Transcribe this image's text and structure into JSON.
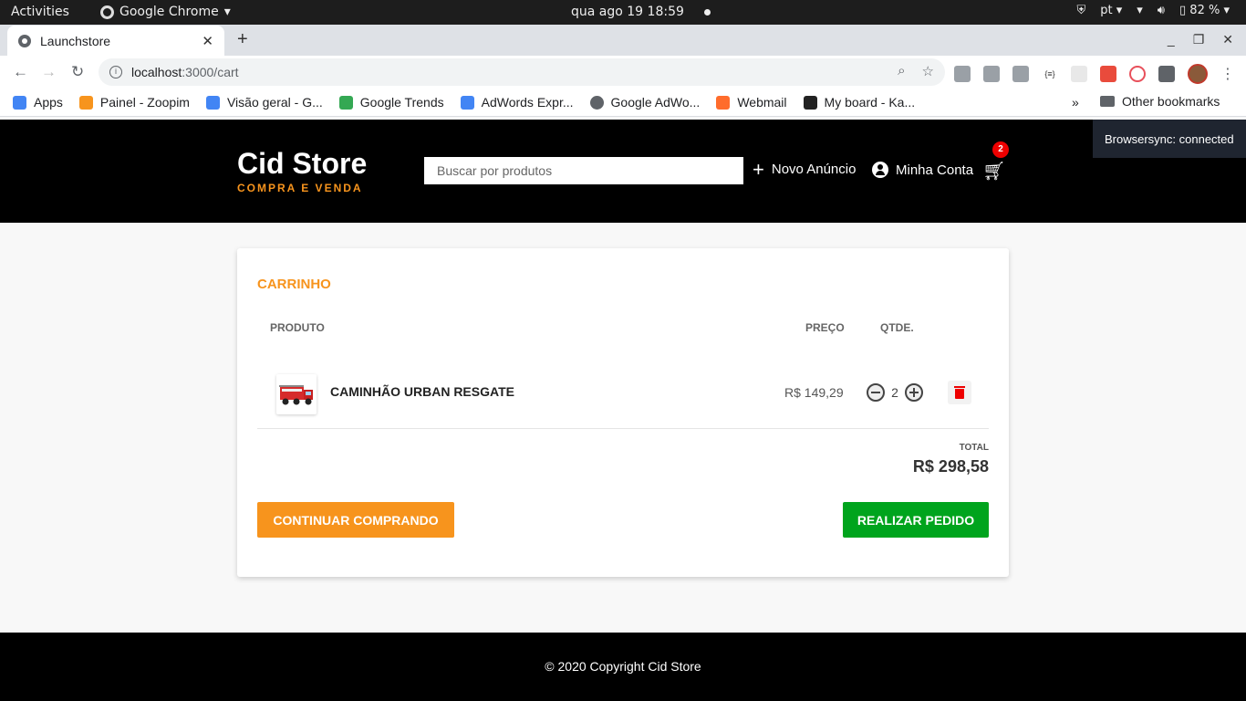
{
  "os_bar": {
    "activities": "Activities",
    "app_name": "Google Chrome",
    "clock": "qua ago 19  18:59",
    "lang": "pt",
    "battery": "82 %"
  },
  "browser": {
    "tab_title": "Launchstore",
    "url_host": "localhost",
    "url_path": ":3000/cart",
    "bookmarks": [
      {
        "label": "Apps",
        "color": "#ea4335"
      },
      {
        "label": "Painel - Zoopim",
        "color": "#f7941d"
      },
      {
        "label": "Visão geral - G...",
        "color": "#4285f4"
      },
      {
        "label": "Google Trends",
        "color": "#34a853"
      },
      {
        "label": "AdWords Expr...",
        "color": "#4285f4"
      },
      {
        "label": "Google AdWo...",
        "color": "#5f6368"
      },
      {
        "label": "Webmail",
        "color": "#ff6c2c"
      },
      {
        "label": "My board - Ka...",
        "color": "#222222"
      }
    ],
    "bookmarks_more": "»",
    "other_bookmarks": "Other bookmarks"
  },
  "site": {
    "logo_title": "Cid Store",
    "logo_tagline": "COMPRA E VENDA",
    "search_placeholder": "Buscar por produtos",
    "new_ad_label": "Novo Anúncio",
    "account_label": "Minha Conta",
    "cart_count": "2",
    "browsersync": "Browsersync: connected",
    "accent_color": "#f7941d",
    "success_color": "#00a41d"
  },
  "cart": {
    "title": "CARRINHO",
    "columns": {
      "product": "PRODUTO",
      "price": "PREÇO",
      "qty": "QTDE."
    },
    "items": [
      {
        "name": "CAMINHÃO URBAN RESGATE",
        "price": "R$ 149,29",
        "qty": "2"
      }
    ],
    "total_label": "TOTAL",
    "total_value": "R$ 298,58",
    "continue_label": "CONTINUAR COMPRANDO",
    "order_label": "REALIZAR PEDIDO"
  },
  "footer": {
    "copyright": "© 2020 Copyright Cid Store"
  }
}
